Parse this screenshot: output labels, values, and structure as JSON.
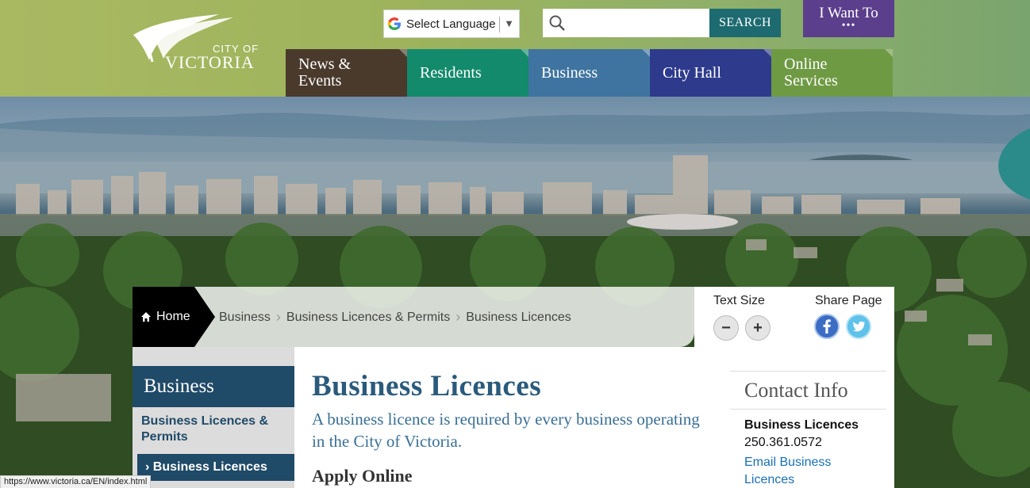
{
  "header": {
    "logo": {
      "line1": "CITY OF",
      "line2": "VICTORIA"
    },
    "language": {
      "label": "Select Language"
    },
    "search": {
      "placeholder": "",
      "button": "SEARCH"
    },
    "i_want_to": {
      "label": "I Want To",
      "dots": "•••"
    },
    "nav": [
      {
        "line1": "News &",
        "line2": "Events",
        "color": "#4a3a2c"
      },
      {
        "line1": "Residents",
        "line2": "",
        "color": "#138a6c"
      },
      {
        "line1": "Business",
        "line2": "",
        "color": "#3f74a0"
      },
      {
        "line1": "City Hall",
        "line2": "",
        "color": "#2e3a8c"
      },
      {
        "line1": "Online",
        "line2": "Services",
        "color": "#6f9a44"
      }
    ]
  },
  "breadcrumb": {
    "home": "Home",
    "items": [
      "Business",
      "Business Licences & Permits",
      "Business Licences"
    ]
  },
  "tools": {
    "text_size": "Text Size",
    "share_page": "Share Page",
    "decrease": "−",
    "increase": "+"
  },
  "sidebar": {
    "heading": "Business",
    "items": [
      {
        "label": "Business Licences & Permits"
      },
      {
        "label": "› Business Licences"
      }
    ]
  },
  "main": {
    "title": "Business Licences",
    "lead": "A business licence is required by every business operating in the City of Victoria.",
    "subheading": "Apply Online"
  },
  "contact": {
    "heading": "Contact Info",
    "name": "Business Licences",
    "phone": "250.361.0572",
    "email_link": "Email Business Licences"
  },
  "status_bar": {
    "url": "https://www.victoria.ca/EN/index.html"
  },
  "colors": {
    "brand_blue": "#1f4a68",
    "title_blue": "#2a5a7c",
    "link_blue": "#1a6fb4",
    "search_teal": "#1d6b70",
    "i_want_purple": "#5b3f8c"
  }
}
